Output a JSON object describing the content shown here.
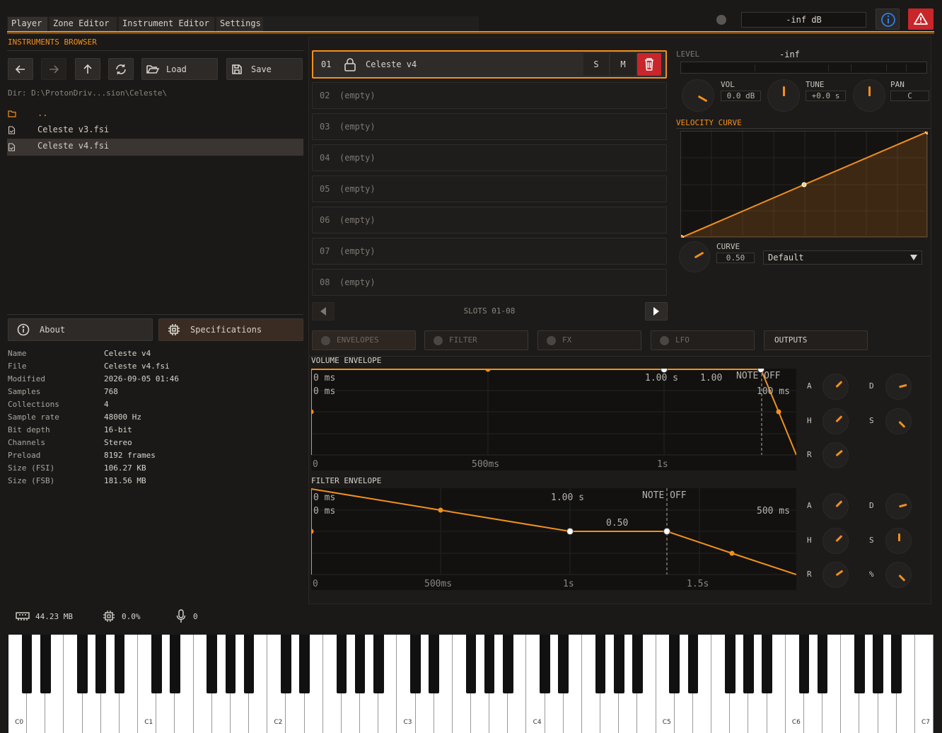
{
  "tabs": [
    {
      "label": "Player"
    },
    {
      "label": "Zone Editor"
    },
    {
      "label": "Instrument Editor"
    },
    {
      "label": "Settings"
    }
  ],
  "header": {
    "db": "-inf dB"
  },
  "browser": {
    "title": "INSTRUMENTS BROWSER",
    "load": "Load",
    "save": "Save",
    "dir": "Dir: D:\\ProtonDriv...sion\\Celeste\\",
    "files": [
      {
        "name": ".."
      },
      {
        "name": "Celeste v3.fsi"
      },
      {
        "name": "Celeste v4.fsi"
      }
    ]
  },
  "info": {
    "about": "About",
    "specs": "Specifications"
  },
  "specs": [
    {
      "k": "Name",
      "v": "Celeste v4"
    },
    {
      "k": "File",
      "v": "Celeste v4.fsi"
    },
    {
      "k": "Modified",
      "v": "2026-09-05  01:46"
    },
    {
      "k": "Samples",
      "v": "768"
    },
    {
      "k": "Collections",
      "v": "4"
    },
    {
      "k": "Sample rate",
      "v": "48000 Hz"
    },
    {
      "k": "Bit depth",
      "v": "16-bit"
    },
    {
      "k": "Channels",
      "v": "Stereo"
    },
    {
      "k": "Preload",
      "v": "8192 frames"
    },
    {
      "k": "Size (FSI)",
      "v": "106.27 KB"
    },
    {
      "k": "Size (FSB)",
      "v": "181.56 MB"
    }
  ],
  "slots": {
    "active": {
      "num": "01",
      "name": "Celeste v4",
      "solo": "S",
      "mute": "M"
    },
    "items": [
      {
        "num": "02",
        "name": "(empty)"
      },
      {
        "num": "03",
        "name": "(empty)"
      },
      {
        "num": "04",
        "name": "(empty)"
      },
      {
        "num": "05",
        "name": "(empty)"
      },
      {
        "num": "06",
        "name": "(empty)"
      },
      {
        "num": "07",
        "name": "(empty)"
      },
      {
        "num": "08",
        "name": "(empty)"
      }
    ],
    "pager": "SLOTS 01-08"
  },
  "mixer": {
    "level_label": "LEVEL",
    "level_val": "-inf",
    "vol_label": "VOL",
    "vol_val": "0.0 dB",
    "tune_label": "TUNE",
    "tune_val": "+0.0 s",
    "pan_label": "PAN",
    "pan_val": "C"
  },
  "velocity": {
    "title": "VELOCITY CURVE",
    "curve_label": "CURVE",
    "curve_val": "0.50",
    "preset": "Default"
  },
  "sections": {
    "envelopes": "ENVELOPES",
    "filter": "FILTER",
    "fx": "FX",
    "lfo": "LFO",
    "outputs": "OUTPUTS"
  },
  "vol_env": {
    "title": "VOLUME ENVELOPE",
    "t1": "0 ms",
    "t2": "0 ms",
    "t3": "1.00 s",
    "t4": "1.00",
    "noteoff": "NOTE OFF",
    "rel": "100 ms",
    "x0": "0",
    "x1": "500ms",
    "x2": "1s",
    "knobs": [
      "A",
      "D",
      "H",
      "S",
      "R"
    ]
  },
  "filt_env": {
    "title": "FILTER ENVELOPE",
    "t1": "0 ms",
    "t2": "0 ms",
    "t3": "1.00 s",
    "noteoff": "NOTE OFF",
    "rel": "500 ms",
    "sus": "0.50",
    "x0": "0",
    "x1": "500ms",
    "x2": "1s",
    "x3": "1.5s",
    "knobs": [
      "A",
      "D",
      "H",
      "S",
      "R",
      "%"
    ]
  },
  "status": {
    "mem": "44.23 MB",
    "cpu": "0.0%",
    "voices": "0"
  },
  "keys": [
    "C0",
    "C1",
    "C2",
    "C3",
    "C4",
    "C5",
    "C6",
    "C7"
  ],
  "colors": {
    "accent": "#f2901e",
    "danger": "#c8262b",
    "info": "#2f7de1"
  }
}
